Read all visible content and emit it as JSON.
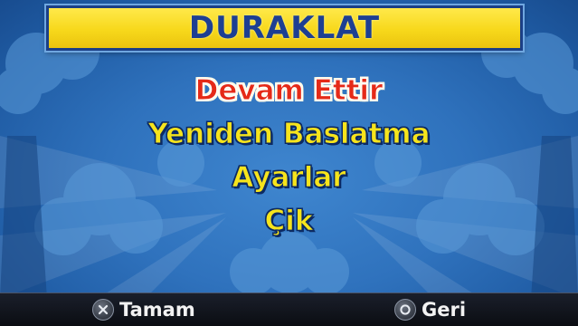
{
  "title": "DURAKLAT",
  "menu": {
    "items": [
      {
        "label": "Devam Ettir",
        "selected": true
      },
      {
        "label": "Yeniden Baslatma",
        "selected": false
      },
      {
        "label": "Ayarlar",
        "selected": false
      },
      {
        "label": "Çik",
        "selected": false
      }
    ]
  },
  "footer": {
    "confirm": {
      "icon": "cross-button-icon",
      "label": "Tamam"
    },
    "back": {
      "icon": "circle-button-icon",
      "label": "Geri"
    }
  },
  "colors": {
    "background": "#2f72bd",
    "title_bar": "#f7d81b",
    "title_text": "#1d3f92",
    "menu_text": "#f6e41c",
    "menu_selected": "#e52a17"
  }
}
